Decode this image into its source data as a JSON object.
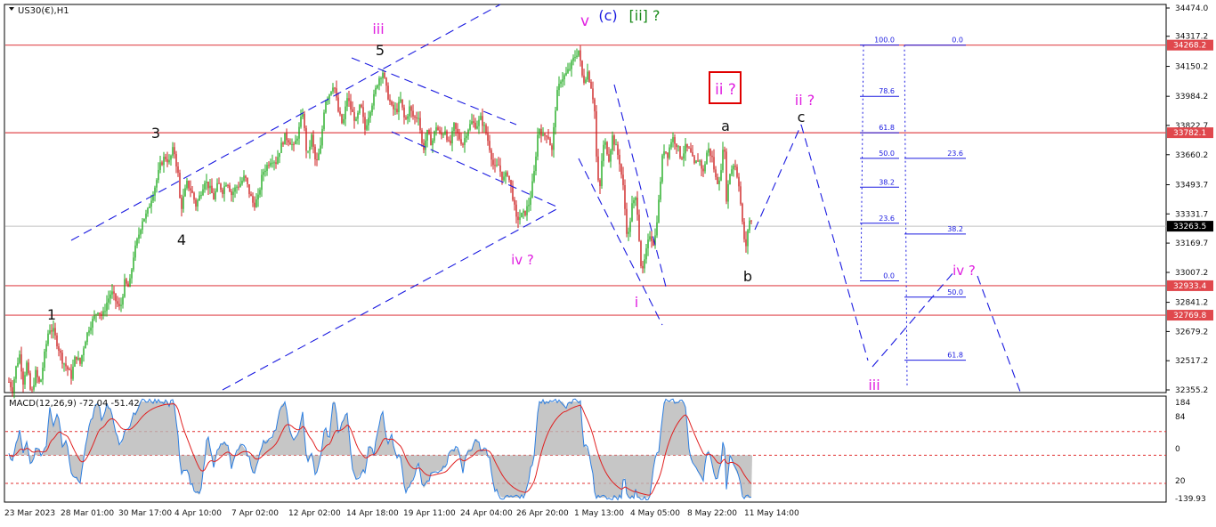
{
  "chart_data": {
    "type": "candlestick",
    "symbol_label": "US30(€),H1",
    "price_ticks": [
      "34474.0",
      "34317.2",
      "34150.2",
      "33984.2",
      "33822.7",
      "33660.2",
      "33493.7",
      "33331.7",
      "33169.7",
      "33007.2",
      "32841.2",
      "32679.2",
      "32517.2",
      "32355.2"
    ],
    "price_range": [
      32320,
      34500
    ],
    "time_labels": [
      "23 Mar 2023",
      "28 Mar 01:00",
      "30 Mar 17:00",
      "4 Apr 10:00",
      "7 Apr 02:00",
      "12 Apr 02:00",
      "14 Apr 18:00",
      "19 Apr 11:00",
      "24 Apr 04:00",
      "26 Apr 20:00",
      "1 May 13:00",
      "4 May 05:00",
      "8 May 22:00",
      "11 May 14:00"
    ],
    "horizontal_levels": [
      {
        "price": 34268.2,
        "label": "34268.2",
        "color": "#e0484d"
      },
      {
        "price": 33782.1,
        "label": "33782.1",
        "color": "#e0484d"
      },
      {
        "price": 32933.4,
        "label": "32933.4",
        "color": "#e0484d"
      },
      {
        "price": 32769.8,
        "label": "32769.8",
        "color": "#e0484d"
      }
    ],
    "current_price": {
      "price": 33263.5,
      "label": "33263.5"
    },
    "fib_retracement_1": [
      {
        "level": "100.0",
        "price": 34268.2
      },
      {
        "level": "78.6",
        "price": 33984
      },
      {
        "level": "61.8",
        "price": 33782
      },
      {
        "level": "50.0",
        "price": 33640
      },
      {
        "level": "38.2",
        "price": 33480
      },
      {
        "level": "23.6",
        "price": 33280
      },
      {
        "level": "0.0",
        "price": 32960
      }
    ],
    "fib_retracement_2": [
      {
        "level": "0.0",
        "price": 34268
      },
      {
        "level": "23.6",
        "price": 33640
      },
      {
        "level": "38.2",
        "price": 33220
      },
      {
        "level": "50.0",
        "price": 32870
      },
      {
        "level": "61.8",
        "price": 32520
      }
    ],
    "wave_labels": [
      {
        "text": "1",
        "color": "#111111"
      },
      {
        "text": "3",
        "color": "#111111"
      },
      {
        "text": "4",
        "color": "#111111"
      },
      {
        "text": "5",
        "color": "#111111"
      },
      {
        "text": "iii",
        "color": "#e020e0"
      },
      {
        "text": "iv ?",
        "color": "#e020e0"
      },
      {
        "text": "v",
        "color": "#e020e0"
      },
      {
        "text": "(c)",
        "color": "#1a1ae0"
      },
      {
        "text": "[ii] ?",
        "color": "#1a8a1a"
      },
      {
        "text": "i",
        "color": "#e020e0"
      },
      {
        "text": "a",
        "color": "#111111"
      },
      {
        "text": "b",
        "color": "#111111"
      },
      {
        "text": "c",
        "color": "#111111"
      },
      {
        "text": "ii ?",
        "color": "#e020e0"
      },
      {
        "text": "ii ?",
        "color": "#e020e0"
      },
      {
        "text": "iii",
        "color": "#e020e0"
      },
      {
        "text": "iv ?",
        "color": "#e020e0"
      }
    ],
    "price_path": [
      [
        0,
        32550
      ],
      [
        4,
        32380
      ],
      [
        8,
        32420
      ],
      [
        14,
        32360
      ],
      [
        18,
        32480
      ],
      [
        22,
        32550
      ],
      [
        26,
        32400
      ],
      [
        30,
        32500
      ],
      [
        35,
        32320
      ],
      [
        40,
        32450
      ],
      [
        45,
        32380
      ],
      [
        50,
        32550
      ],
      [
        55,
        32700
      ],
      [
        60,
        32680
      ],
      [
        65,
        32600
      ],
      [
        70,
        32520
      ],
      [
        75,
        32480
      ],
      [
        80,
        32430
      ],
      [
        85,
        32550
      ],
      [
        90,
        32500
      ],
      [
        95,
        32620
      ],
      [
        100,
        32700
      ],
      [
        105,
        32750
      ],
      [
        110,
        32800
      ],
      [
        115,
        32760
      ],
      [
        120,
        32840
      ],
      [
        125,
        32900
      ],
      [
        130,
        32850
      ],
      [
        135,
        32800
      ],
      [
        140,
        32950
      ],
      [
        145,
        32920
      ],
      [
        150,
        33100
      ],
      [
        155,
        33200
      ],
      [
        160,
        33300
      ],
      [
        165,
        33330
      ],
      [
        170,
        33420
      ],
      [
        175,
        33500
      ],
      [
        180,
        33600
      ],
      [
        185,
        33650
      ],
      [
        190,
        33620
      ],
      [
        195,
        33700
      ],
      [
        200,
        33550
      ],
      [
        203,
        33350
      ],
      [
        206,
        33420
      ],
      [
        210,
        33500
      ],
      [
        215,
        33460
      ],
      [
        220,
        33380
      ],
      [
        225,
        33440
      ],
      [
        230,
        33520
      ],
      [
        235,
        33480
      ],
      [
        240,
        33420
      ],
      [
        245,
        33500
      ],
      [
        250,
        33460
      ],
      [
        255,
        33520
      ],
      [
        260,
        33440
      ],
      [
        265,
        33480
      ],
      [
        270,
        33500
      ],
      [
        275,
        33540
      ],
      [
        280,
        33450
      ],
      [
        285,
        33380
      ],
      [
        290,
        33420
      ],
      [
        295,
        33560
      ],
      [
        300,
        33600
      ],
      [
        305,
        33640
      ],
      [
        310,
        33620
      ],
      [
        315,
        33700
      ],
      [
        320,
        33760
      ],
      [
        325,
        33740
      ],
      [
        330,
        33700
      ],
      [
        335,
        33780
      ],
      [
        340,
        33900
      ],
      [
        345,
        33640
      ],
      [
        350,
        33760
      ],
      [
        355,
        33600
      ],
      [
        360,
        33700
      ],
      [
        365,
        33960
      ],
      [
        370,
        34000
      ],
      [
        375,
        34060
      ],
      [
        380,
        33900
      ],
      [
        385,
        33820
      ],
      [
        390,
        33980
      ],
      [
        395,
        33900
      ],
      [
        400,
        33840
      ],
      [
        405,
        33940
      ],
      [
        410,
        33800
      ],
      [
        415,
        33900
      ],
      [
        420,
        33980
      ],
      [
        425,
        34080
      ],
      [
        430,
        34120
      ],
      [
        435,
        34000
      ],
      [
        440,
        33920
      ],
      [
        445,
        33900
      ],
      [
        450,
        33960
      ],
      [
        455,
        33840
      ],
      [
        460,
        33920
      ],
      [
        465,
        33860
      ],
      [
        470,
        33880
      ],
      [
        475,
        33680
      ],
      [
        480,
        33780
      ],
      [
        485,
        33720
      ],
      [
        490,
        33820
      ],
      [
        495,
        33760
      ],
      [
        500,
        33800
      ],
      [
        505,
        33700
      ],
      [
        510,
        33820
      ],
      [
        515,
        33760
      ],
      [
        520,
        33720
      ],
      [
        525,
        33800
      ],
      [
        530,
        33840
      ],
      [
        535,
        33820
      ],
      [
        540,
        33860
      ],
      [
        545,
        33800
      ],
      [
        550,
        33700
      ],
      [
        555,
        33580
      ],
      [
        560,
        33600
      ],
      [
        565,
        33520
      ],
      [
        570,
        33560
      ],
      [
        575,
        33460
      ],
      [
        580,
        33300
      ],
      [
        585,
        33320
      ],
      [
        590,
        33340
      ],
      [
        595,
        33400
      ],
      [
        600,
        33560
      ],
      [
        605,
        33820
      ],
      [
        610,
        33760
      ],
      [
        615,
        33780
      ],
      [
        620,
        33680
      ],
      [
        625,
        33980
      ],
      [
        630,
        34080
      ],
      [
        635,
        34100
      ],
      [
        640,
        34140
      ],
      [
        645,
        34200
      ],
      [
        650,
        34240
      ],
      [
        655,
        34060
      ],
      [
        660,
        34120
      ],
      [
        665,
        34020
      ],
      [
        668,
        33900
      ],
      [
        671,
        33520
      ],
      [
        674,
        33480
      ],
      [
        677,
        33700
      ],
      [
        680,
        33720
      ],
      [
        684,
        33640
      ],
      [
        688,
        33760
      ],
      [
        692,
        33700
      ],
      [
        696,
        33620
      ],
      [
        700,
        33480
      ],
      [
        705,
        33180
      ],
      [
        710,
        33380
      ],
      [
        715,
        33420
      ],
      [
        718,
        33200
      ],
      [
        721,
        32980
      ],
      [
        725,
        33100
      ],
      [
        730,
        33220
      ],
      [
        735,
        33160
      ],
      [
        740,
        33400
      ],
      [
        745,
        33700
      ],
      [
        750,
        33660
      ],
      [
        755,
        33760
      ],
      [
        760,
        33720
      ],
      [
        765,
        33640
      ],
      [
        770,
        33700
      ],
      [
        775,
        33680
      ],
      [
        780,
        33600
      ],
      [
        785,
        33640
      ],
      [
        790,
        33560
      ],
      [
        795,
        33700
      ],
      [
        800,
        33640
      ],
      [
        805,
        33500
      ],
      [
        810,
        33560
      ],
      [
        813,
        33780
      ],
      [
        816,
        33420
      ],
      [
        820,
        33560
      ],
      [
        825,
        33620
      ],
      [
        830,
        33500
      ],
      [
        835,
        33220
      ],
      [
        838,
        33140
      ],
      [
        841,
        33300
      ],
      [
        845,
        33280
      ]
    ],
    "macd": {
      "label": "MACD(12,26,9) -72.04 -51.42",
      "ticks": [
        "184",
        "84",
        "0",
        "20",
        "-139.93"
      ],
      "range": [
        -160,
        200
      ]
    }
  }
}
